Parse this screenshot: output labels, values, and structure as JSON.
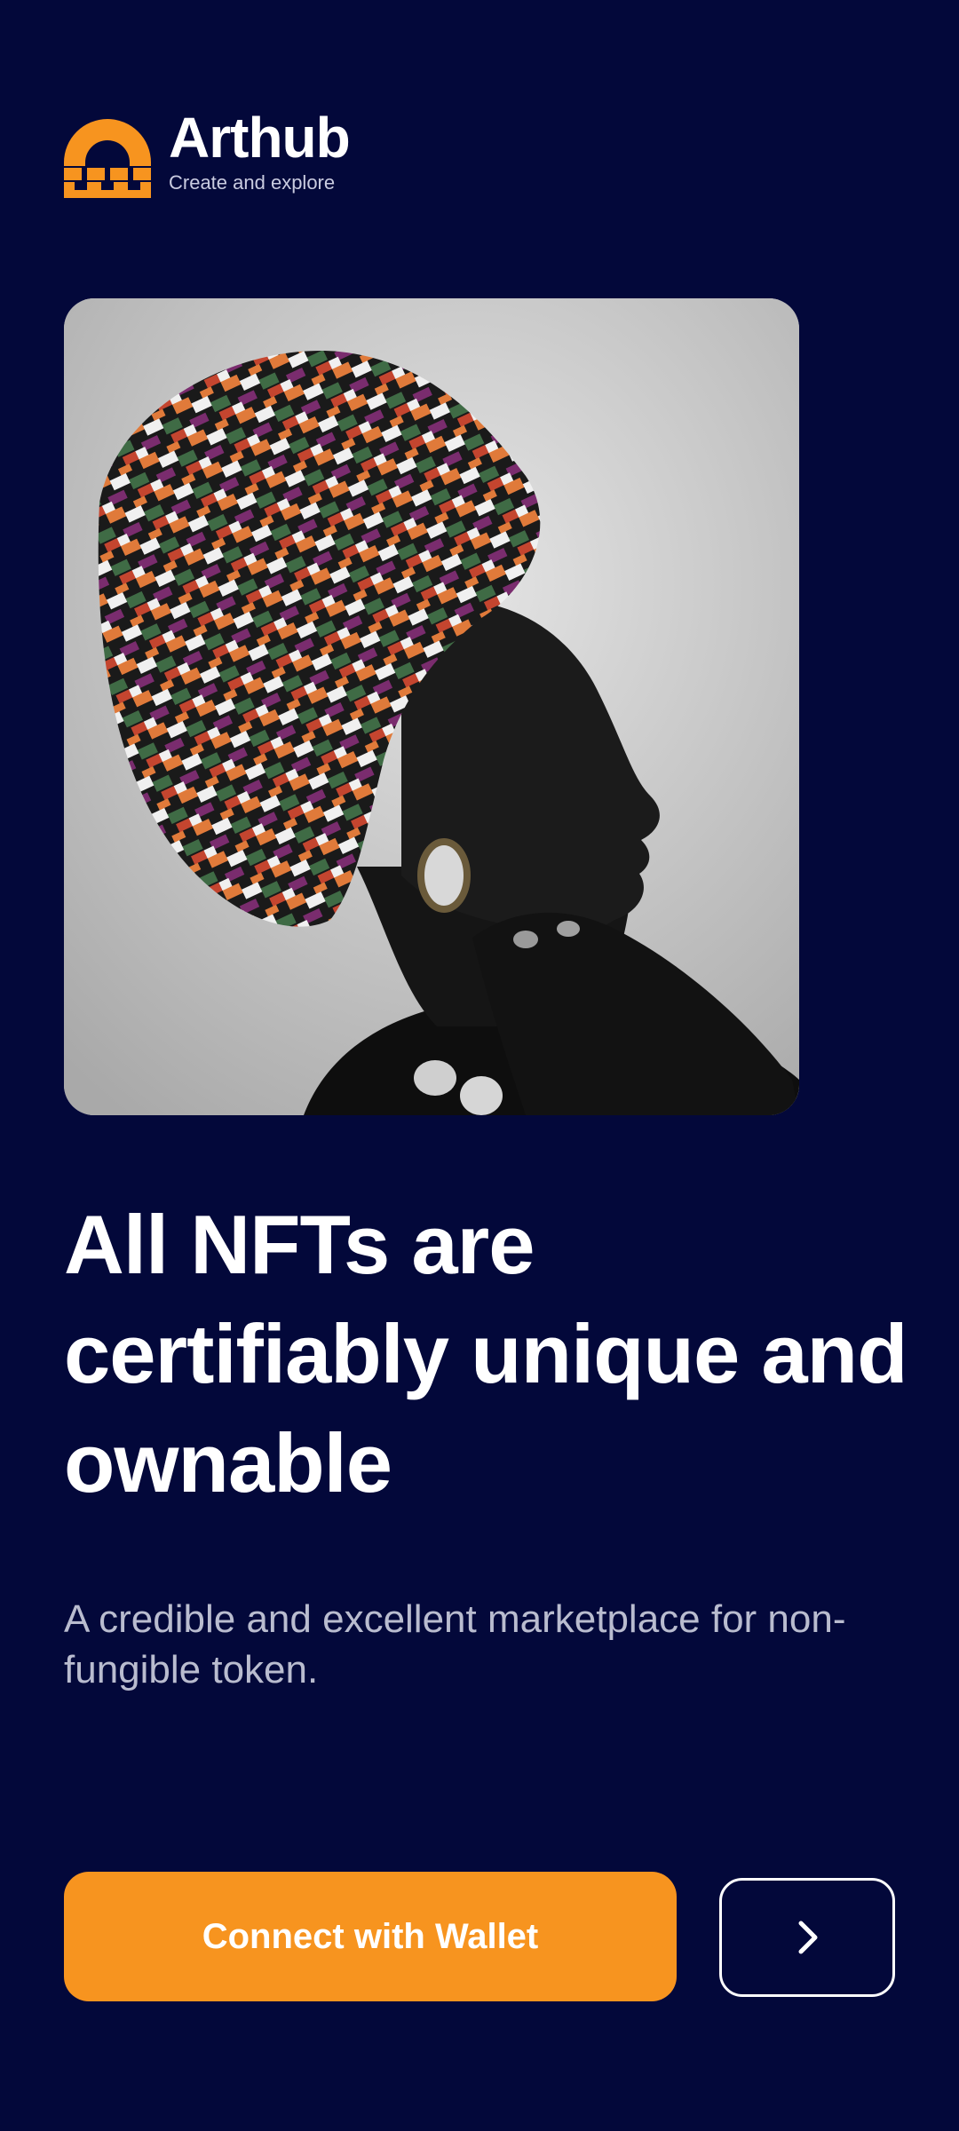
{
  "brand": {
    "name": "Arthub",
    "tagline": "Create and explore",
    "logo_icon": "arch-logo-icon",
    "accent_color": "#f7941f"
  },
  "hero_image": {
    "description_icon": "portrait-image"
  },
  "headline": "All NFTs are certifiably unique and ownable",
  "subtitle": "A credible and excellent marketplace for non-fungible token.",
  "actions": {
    "connect_label": "Connect with Wallet",
    "next_icon": "chevron-right-icon"
  },
  "colors": {
    "background": "#03083a",
    "primary": "#f7941f",
    "text": "#ffffff",
    "muted": "#b9bccf"
  }
}
